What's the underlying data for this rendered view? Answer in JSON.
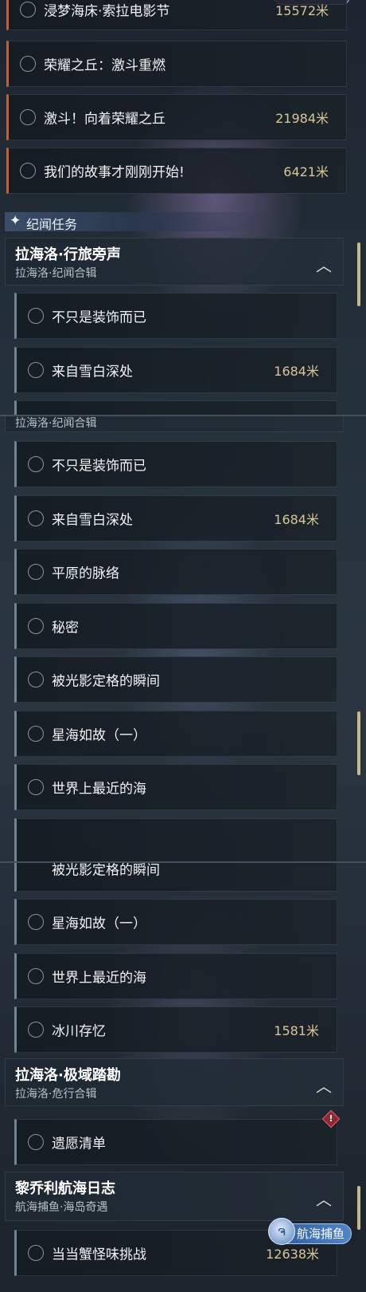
{
  "top_tasks": [
    {
      "name": "浸梦海床·索拉电影节",
      "distance": "15572米"
    },
    {
      "name": "荣耀之丘：激斗重燃",
      "distance": ""
    },
    {
      "name": "激斗！向着荣耀之丘",
      "distance": "21984米"
    },
    {
      "name": "我们的故事才刚刚开始!",
      "distance": "6421米"
    }
  ],
  "section": {
    "title": "纪闻任务",
    "icon": "sparkle-icon"
  },
  "groups": [
    {
      "title": "拉海洛·行旅旁声",
      "subtitle": "拉海洛·纪闻合辑",
      "items": [
        {
          "name": "不只是装饰而已",
          "distance": ""
        },
        {
          "name": "来自雪白深处",
          "distance": "1684米"
        },
        {
          "name": "平原的脉络",
          "distance": ""
        },
        {
          "name": "秘密",
          "distance": ""
        },
        {
          "name": "被光影定格的瞬间",
          "distance": ""
        },
        {
          "name": "星海如故（一）",
          "distance": ""
        },
        {
          "name": "世界上最近的海",
          "distance": ""
        },
        {
          "name": "冰川存忆",
          "distance": "1581米"
        }
      ]
    },
    {
      "title": "拉海洛·极域踏勘",
      "subtitle": "拉海洛·危行合辑",
      "items": [
        {
          "name": "遗愿清单",
          "distance": "",
          "alert": "!"
        }
      ]
    },
    {
      "title": "黎乔利航海日志",
      "subtitle": "航海捕鱼·海岛奇遇",
      "badge": "航海捕鱼",
      "items": [
        {
          "name": "当当蟹怪味挑战",
          "distance": "12638米"
        }
      ]
    }
  ],
  "colors": {
    "distance": "#d7c697",
    "accent_orange": "#c2603a",
    "accent_blue": "#6f8595",
    "accent_gold": "#c8b98a"
  }
}
